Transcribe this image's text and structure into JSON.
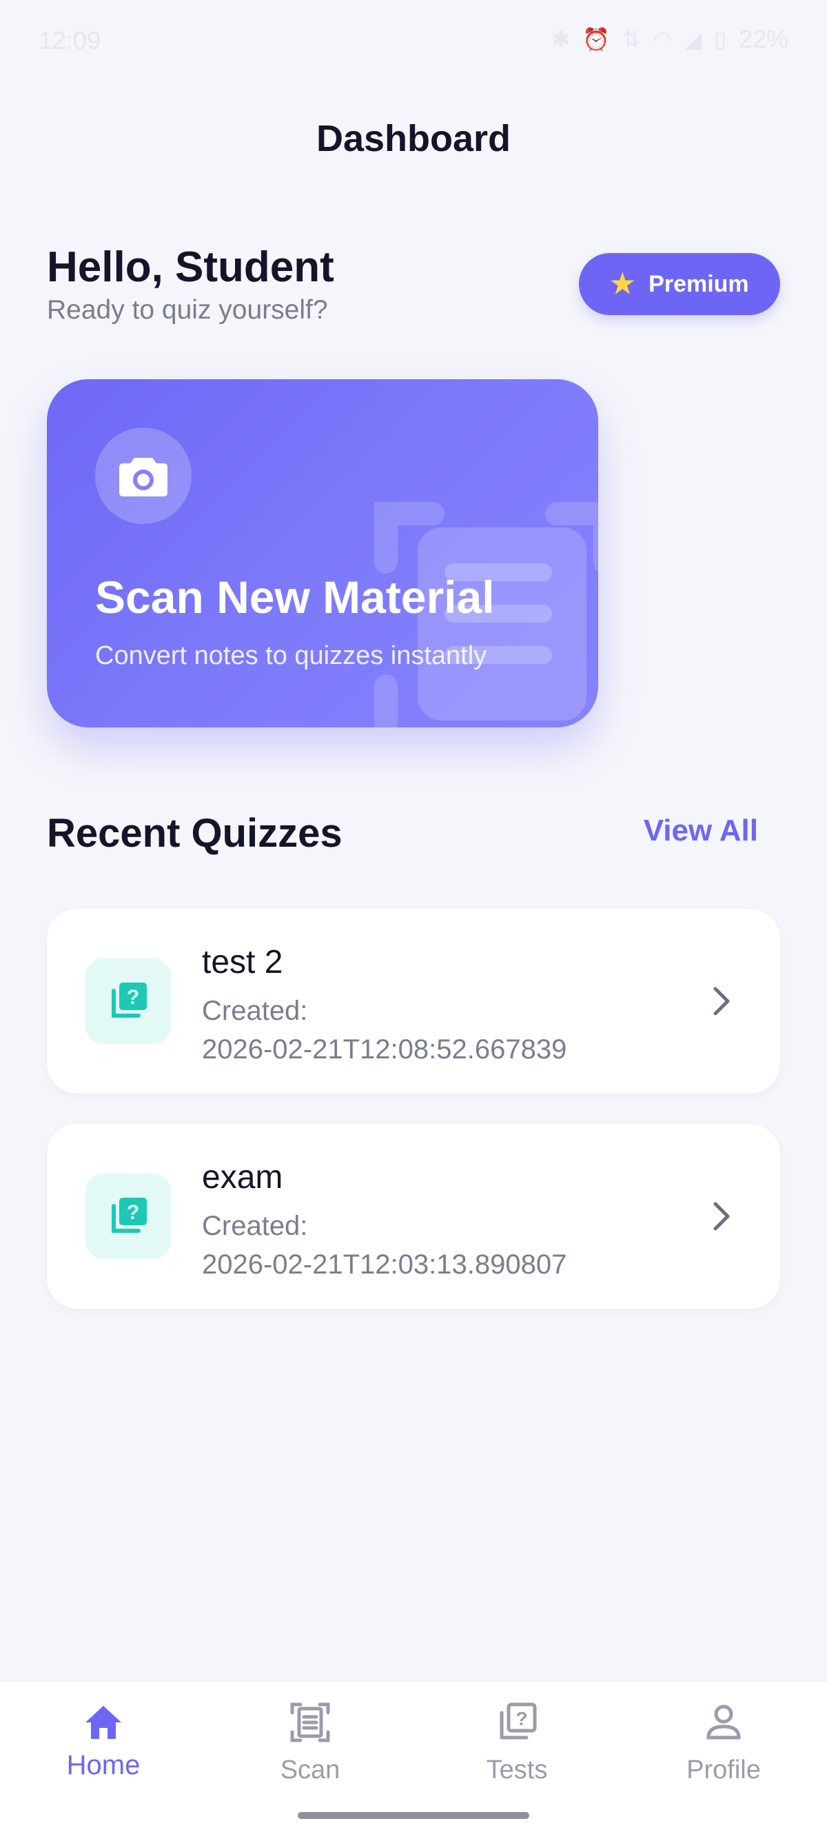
{
  "status_bar": {
    "time": "12:09",
    "battery": "22%",
    "icons": [
      "bluetooth-icon",
      "alarm-icon",
      "data-arrows-icon",
      "wifi-icon",
      "signal-icon",
      "battery-icon"
    ]
  },
  "header": {
    "title": "Dashboard"
  },
  "greeting": {
    "title": "Hello, Student",
    "subtitle": "Ready to quiz yourself?",
    "premium_label": "Premium",
    "premium_icon": "star-icon"
  },
  "scan_card": {
    "title": "Scan New Material",
    "subtitle": "Convert notes to quizzes instantly",
    "icon": "camera-icon"
  },
  "recent": {
    "title": "Recent Quizzes",
    "view_all": "View All",
    "quizzes": [
      {
        "name": "test 2",
        "created_label": "Created:",
        "created_value": "2026-02-21T12:08:52.667839"
      },
      {
        "name": "exam",
        "created_label": "Created:",
        "created_value": "2026-02-21T12:03:13.890807"
      }
    ]
  },
  "nav": {
    "items": [
      {
        "label": "Home",
        "icon": "home-icon",
        "active": true
      },
      {
        "label": "Scan",
        "icon": "document-scan-icon",
        "active": false
      },
      {
        "label": "Tests",
        "icon": "quiz-icon",
        "active": false
      },
      {
        "label": "Profile",
        "icon": "person-icon",
        "active": false
      }
    ]
  },
  "colors": {
    "accent": "#6d66f4",
    "background": "#f5f6fb",
    "teal": "#1ec8b4",
    "text_primary": "#14142b",
    "text_secondary": "#7a7d90"
  }
}
